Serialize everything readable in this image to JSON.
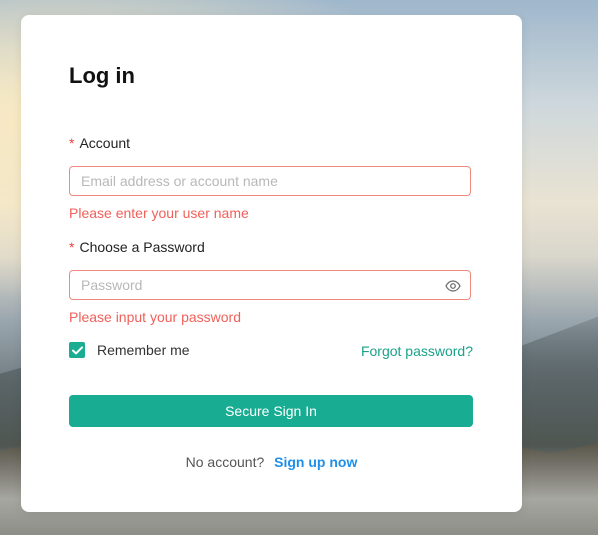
{
  "form": {
    "title": "Log in",
    "account": {
      "required_mark": "*",
      "label": "Account",
      "placeholder": "Email address or account name",
      "value": "",
      "error": "Please enter your user name"
    },
    "password": {
      "required_mark": "*",
      "label": "Choose a Password",
      "placeholder": "Password",
      "value": "",
      "error": "Please input your password",
      "toggle_icon": "eye-icon"
    },
    "remember": {
      "label": "Remember me",
      "checked": true
    },
    "forgot_label": "Forgot password?",
    "submit_label": "Secure Sign In",
    "signup": {
      "prompt": "No account?",
      "link_label": "Sign up now"
    }
  },
  "colors": {
    "accent": "#18ad92",
    "error": "#f0605a",
    "link": "#1f8fe8",
    "required": "#e8403e"
  }
}
